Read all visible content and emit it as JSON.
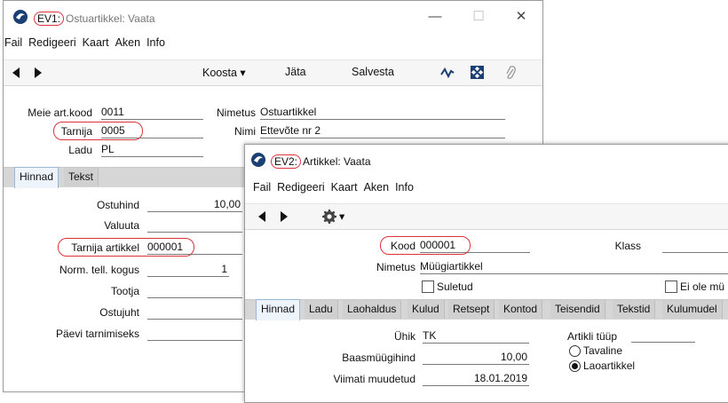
{
  "win1": {
    "tag": "EV1:",
    "title": "Ostuartikkel: Vaata",
    "menu": [
      "Fail",
      "Redigeeri",
      "Kaart",
      "Aken",
      "Info"
    ],
    "toolbar": {
      "koosta": "Koosta",
      "jata": "Jäta",
      "salvesta": "Salvesta"
    },
    "fields": {
      "meie_art_kood_label": "Meie art.kood",
      "meie_art_kood": "0011",
      "nimetus_label": "Nimetus",
      "nimetus": "Ostuartikkel",
      "tarnija_label": "Tarnija",
      "tarnija": "0005",
      "nimi_label": "Nimi",
      "nimi": "Ettevõte nr 2",
      "ladu_label": "Ladu",
      "ladu": "PL"
    },
    "tabs": [
      "Hinnad",
      "Tekst"
    ],
    "hinnad": {
      "ostuhind_label": "Ostuhind",
      "ostuhind": "10,00",
      "valuuta_label": "Valuuta",
      "valuuta": "",
      "tarnija_artikkel_label": "Tarnija artikkel",
      "tarnija_artikkel": "000001",
      "norm_kogus_label": "Norm. tell. kogus",
      "norm_kogus": "1",
      "tootja_label": "Tootja",
      "tootja": "",
      "ostujuht_label": "Ostujuht",
      "ostujuht": "",
      "paevi_label": "Päevi tarnimiseks",
      "paevi": ""
    }
  },
  "win2": {
    "tag": "EV2:",
    "title": "Artikkel: Vaata",
    "menu": [
      "Fail",
      "Redigeeri",
      "Kaart",
      "Aken",
      "Info"
    ],
    "fields": {
      "kood_label": "Kood",
      "kood": "000001",
      "klass_label": "Klass",
      "klass": "",
      "nimetus_label": "Nimetus",
      "nimetus": "Müügiartikkel",
      "suletud_label": "Suletud",
      "ei_ole_label": "Ei ole mü"
    },
    "tabs": [
      "Hinnad",
      "Ladu",
      "Laohaldus",
      "Kulud",
      "Retsept",
      "Kontod",
      "Teisendid",
      "Tekstid",
      "Kulumudel"
    ],
    "hinnad": {
      "uhik_label": "Ühik",
      "uhik": "TK",
      "baasmuugihind_label": "Baasmüügihind",
      "baasmuugihind": "10,00",
      "viimati_label": "Viimati muudetud",
      "viimati": "18.01.2019",
      "artikli_tuup_label": "Artikli tüüp",
      "tavaline": "Tavaline",
      "laoartikkel": "Laoartikkel"
    }
  },
  "colors": {
    "highlight": "#d9343a",
    "active_tab": "#eef4fb",
    "tab_bg": "#d0d0d0"
  }
}
